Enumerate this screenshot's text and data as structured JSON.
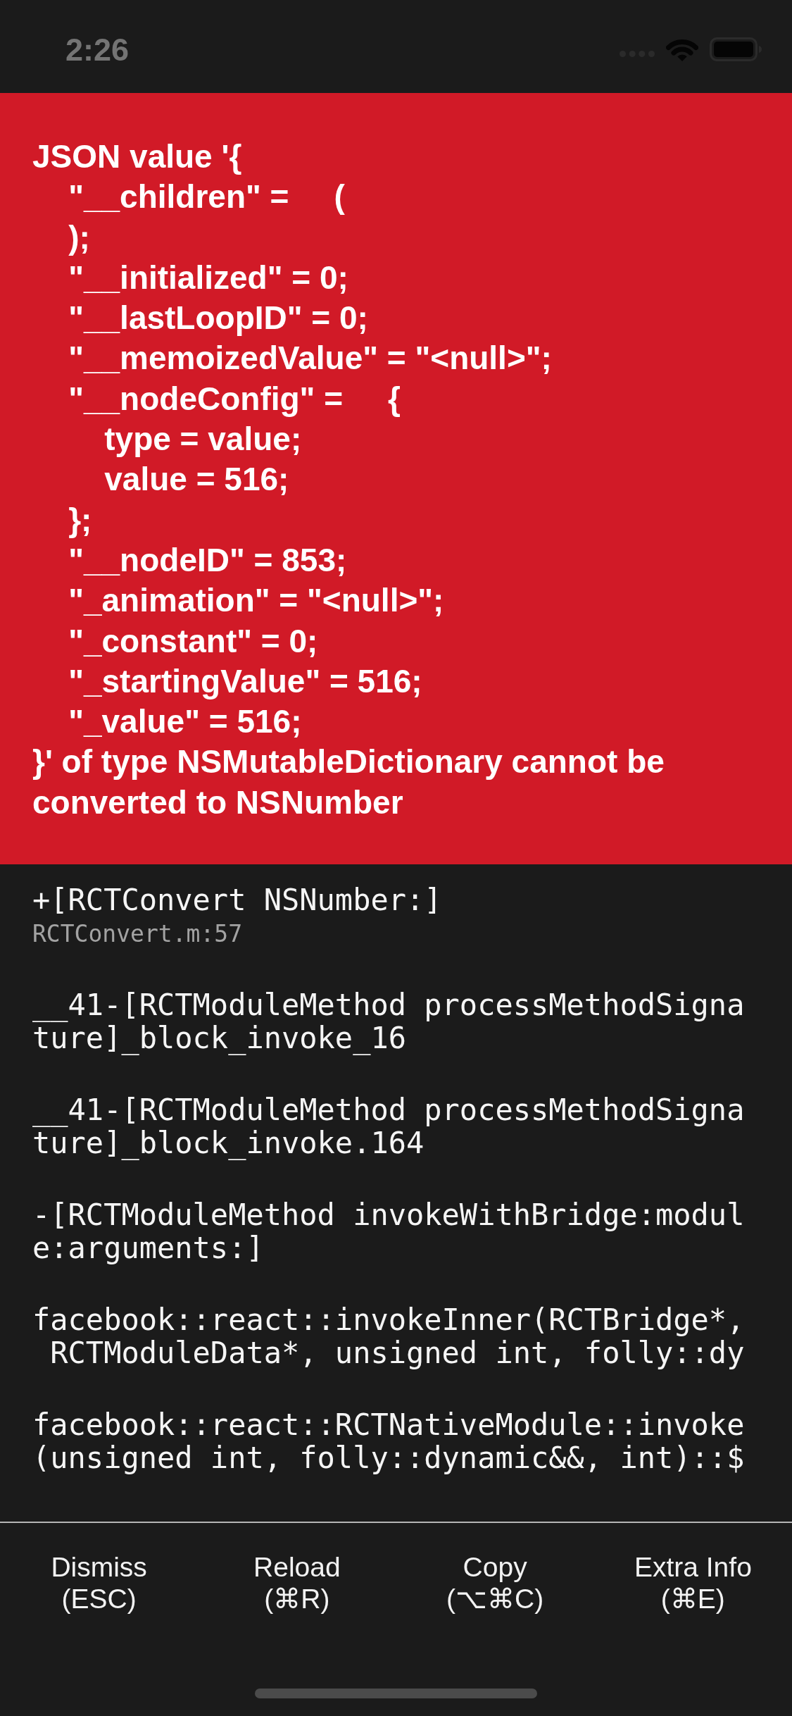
{
  "status_bar": {
    "time": "2:26"
  },
  "error": {
    "message": "JSON value '{\n    \"__children\" =     (\n    );\n    \"__initialized\" = 0;\n    \"__lastLoopID\" = 0;\n    \"__memoizedValue\" = \"<null>\";\n    \"__nodeConfig\" =     {\n        type = value;\n        value = 516;\n    };\n    \"__nodeID\" = 853;\n    \"_animation\" = \"<null>\";\n    \"_constant\" = 0;\n    \"_startingValue\" = 516;\n    \"_value\" = 516;\n}' of type NSMutableDictionary cannot be converted to NSNumber"
  },
  "stack_frames": [
    {
      "method": "+[RCTConvert NSNumber:]",
      "file": "RCTConvert.m:57"
    },
    {
      "method": "__41-[RCTModuleMethod processMethodSignature]_block_invoke_16"
    },
    {
      "method": "__41-[RCTModuleMethod processMethodSignature]_block_invoke.164"
    },
    {
      "method": "-[RCTModuleMethod invokeWithBridge:module:arguments:]"
    },
    {
      "method": "facebook::react::invokeInner(RCTBridge*, RCTModuleData*, unsigned int, folly::dy"
    },
    {
      "method": "facebook::react::RCTNativeModule::invoke(unsigned int, folly::dynamic&&, int)::$"
    }
  ],
  "actions": [
    {
      "label": "Dismiss",
      "shortcut": "(ESC)"
    },
    {
      "label": "Reload",
      "shortcut": "(⌘R)"
    },
    {
      "label": "Copy",
      "shortcut": "(⌥⌘C)"
    },
    {
      "label": "Extra Info",
      "shortcut": "(⌘E)"
    }
  ]
}
